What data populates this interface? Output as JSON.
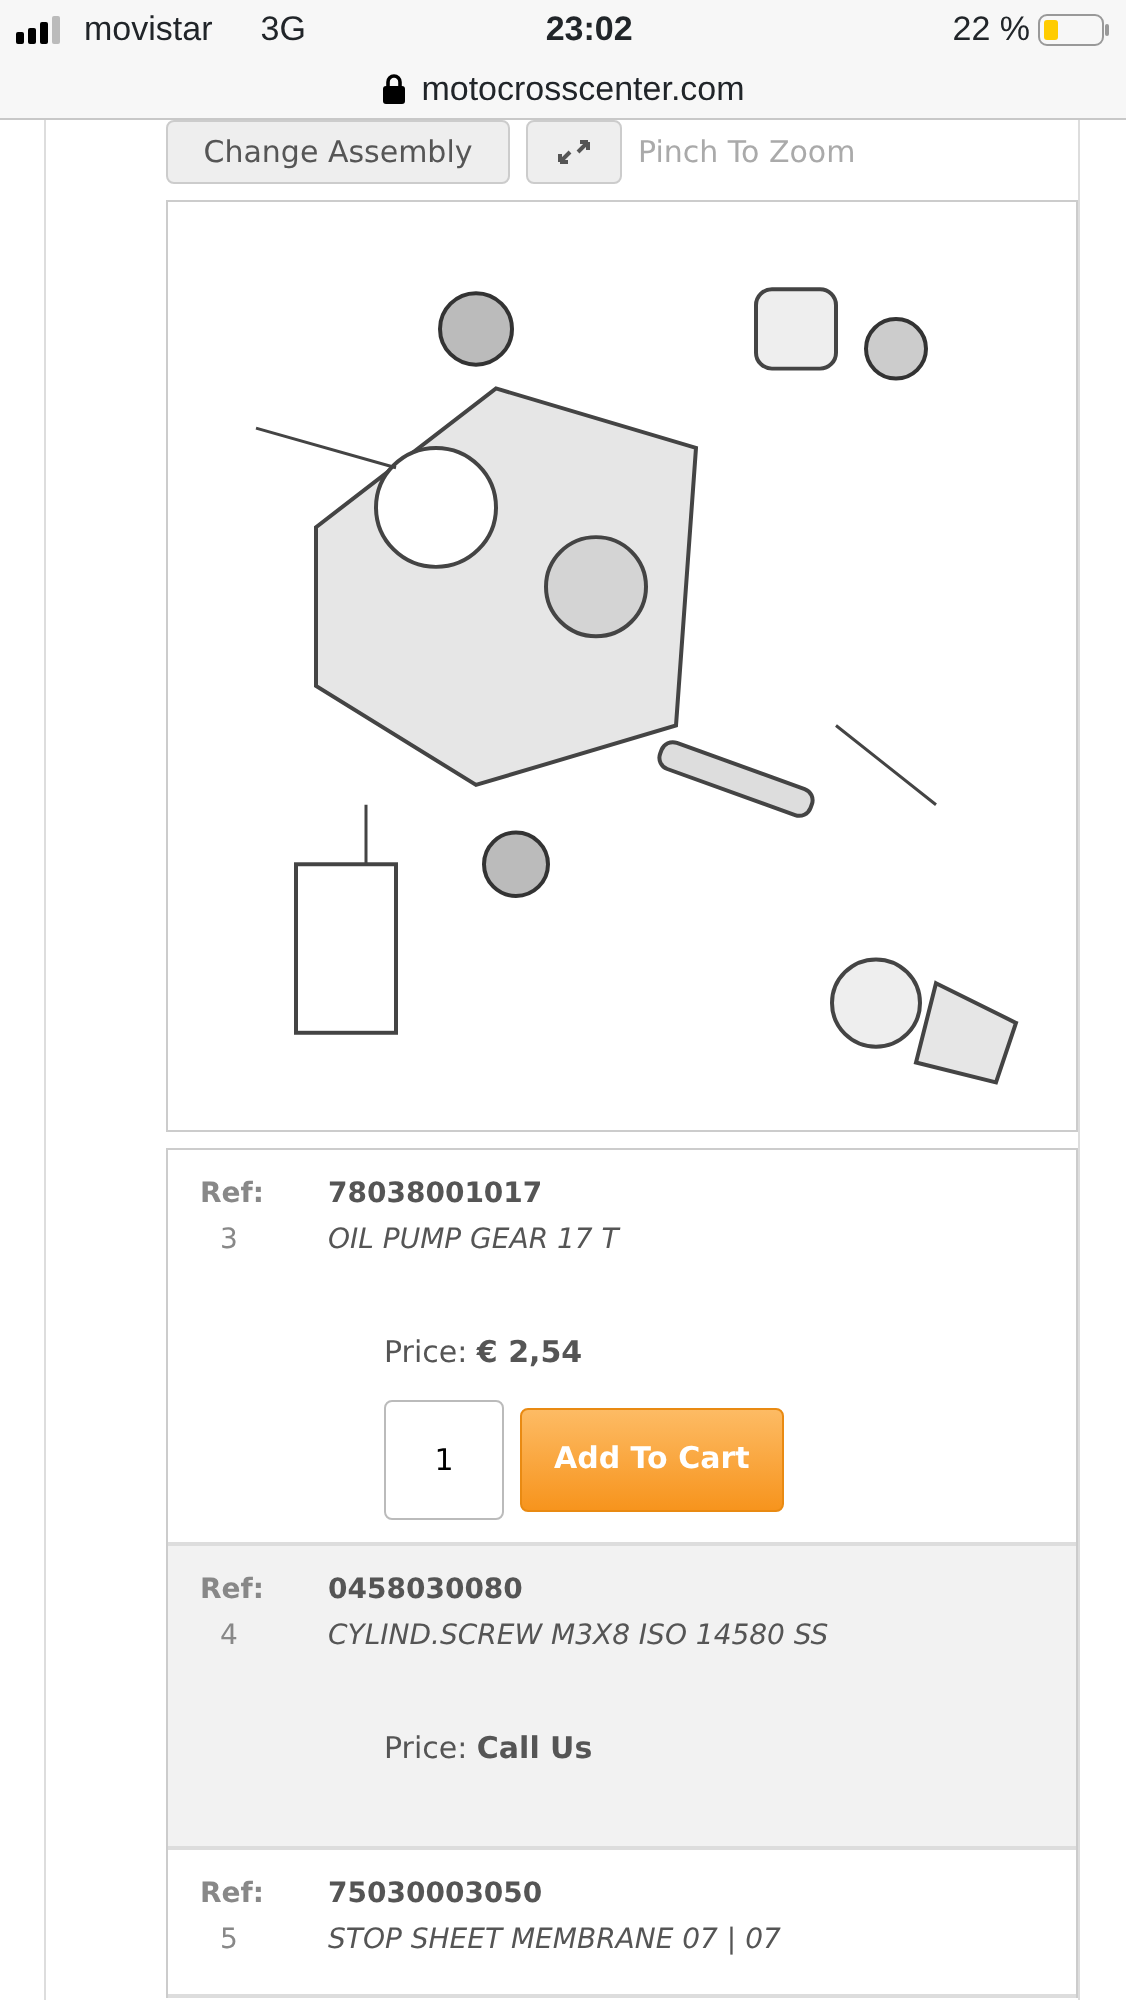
{
  "status_bar": {
    "carrier": "movistar",
    "network": "3G",
    "time": "23:02",
    "battery": "22 %"
  },
  "address_bar": {
    "url": "motocrosscenter.com"
  },
  "toolbar": {
    "change_button": "Change Assembly",
    "zoom_hint": "Pinch To Zoom"
  },
  "diagram": {
    "kind": "picture"
  },
  "parts": [
    {
      "ref_label": "Ref:",
      "ref_number": "78038001017",
      "index": "3",
      "description": "OIL PUMP GEAR 17 T",
      "price_label": "Price:",
      "price": "€ 2,54",
      "quantity": "1",
      "add_button": "Add To Cart"
    },
    {
      "ref_label": "Ref:",
      "ref_number": "0458030080",
      "index": "4",
      "description": "CYLIND.SCREW M3X8 ISO 14580 SS",
      "price_label": "Price:",
      "price": "Call Us"
    },
    {
      "ref_label": "Ref:",
      "ref_number": "75030003050",
      "index": "5",
      "description": "STOP SHEET MEMBRANE 07 | 07"
    }
  ]
}
